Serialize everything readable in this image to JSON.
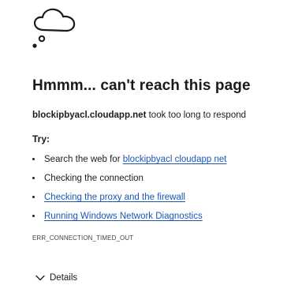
{
  "icon": "cloud-disconnected-icon",
  "title": "Hmmm... can't reach this page",
  "message": {
    "host": "blockipbyacl.cloudapp.net",
    "text": " took too long to respond"
  },
  "try_label": "Try:",
  "suggestions": [
    {
      "prefix": "Search the web for ",
      "link": "blockipbyacl cloudapp net"
    },
    {
      "prefix": "Checking the connection",
      "link": ""
    },
    {
      "prefix": "",
      "link": "Checking the proxy and the firewall"
    },
    {
      "prefix": "",
      "link": "Running Windows Network Diagnostics"
    }
  ],
  "error_code": "ERR_CONNECTION_TIMED_OUT",
  "details_label": "Details",
  "colors": {
    "text": "#1b1b1b",
    "link": "#1a56b8",
    "background": "#ffffff"
  }
}
